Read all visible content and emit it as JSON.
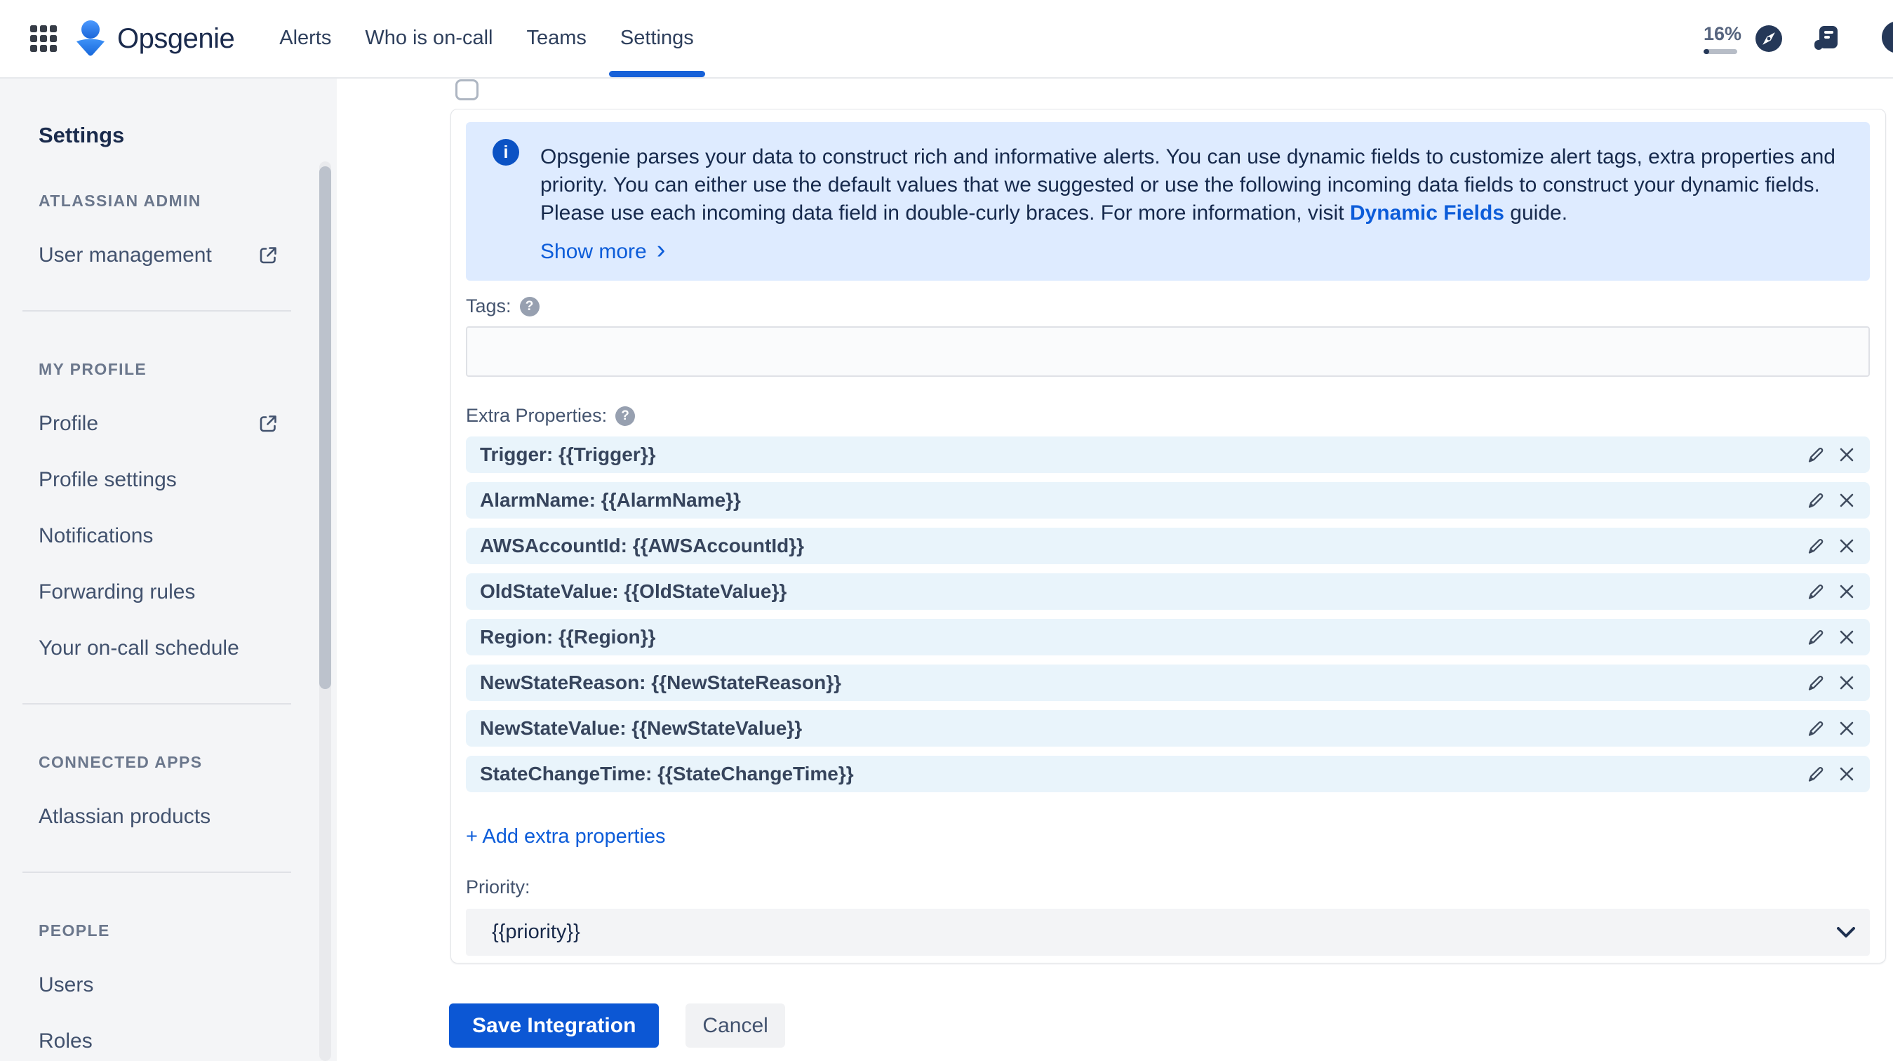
{
  "header": {
    "brand": "Opsgenie",
    "nav": [
      {
        "label": "Alerts",
        "active": false
      },
      {
        "label": "Who is on-call",
        "active": false
      },
      {
        "label": "Teams",
        "active": false
      },
      {
        "label": "Settings",
        "active": true
      }
    ],
    "usage_percent": "16%",
    "usage_fraction": 0.16,
    "help_glyph": "?",
    "icons": {
      "app_switcher": "app-switcher-grid",
      "compass": "compass-explore",
      "release_notes": "release-notes-document",
      "help": "question-mark-circle"
    }
  },
  "sidebar": {
    "title": "Settings",
    "sections": [
      {
        "label": "ATLASSIAN ADMIN",
        "items": [
          {
            "label": "User management",
            "external": true
          }
        ]
      },
      {
        "label": "MY PROFILE",
        "items": [
          {
            "label": "Profile",
            "external": true
          },
          {
            "label": "Profile settings",
            "external": false
          },
          {
            "label": "Notifications",
            "external": false
          },
          {
            "label": "Forwarding rules",
            "external": false
          },
          {
            "label": "Your on-call schedule",
            "external": false
          }
        ]
      },
      {
        "label": "CONNECTED APPS",
        "items": [
          {
            "label": "Atlassian products",
            "external": false
          }
        ]
      },
      {
        "label": "PEOPLE",
        "items": [
          {
            "label": "Users",
            "external": false
          },
          {
            "label": "Roles",
            "external": false
          }
        ]
      }
    ]
  },
  "main": {
    "banner": {
      "line1": "Opsgenie parses your data to construct rich and informative alerts. You can use dynamic fields to customize alert tags, extra properties and",
      "line2": "priority. You can either use the default values that we suggested or use the following incoming data fields to construct your dynamic fields.",
      "line3_pre": "Please use each incoming data field in double-curly braces. For more information, visit ",
      "line3_link": "Dynamic Fields",
      "line3_post": " guide.",
      "show_more": "Show more",
      "show_more_chevron": "›",
      "info_glyph": "i"
    },
    "tags": {
      "label": "Tags:",
      "value": "",
      "help_glyph": "?"
    },
    "extra_properties": {
      "label": "Extra Properties:",
      "help_glyph": "?",
      "rows": [
        "Trigger: {{Trigger}}",
        "AlarmName: {{AlarmName}}",
        "AWSAccountId: {{AWSAccountId}}",
        "OldStateValue: {{OldStateValue}}",
        "Region: {{Region}}",
        "NewStateReason: {{NewStateReason}}",
        "NewStateValue: {{NewStateValue}}",
        "StateChangeTime: {{StateChangeTime}}"
      ],
      "add_label": "+ Add extra properties"
    },
    "priority": {
      "label": "Priority:",
      "value": "{{priority}}"
    },
    "buttons": {
      "save": "Save Integration",
      "cancel": "Cancel"
    }
  },
  "colors": {
    "brand_navy": "#172B4D",
    "accent_blue": "#0C5CD9",
    "tab_underline": "#1761D8",
    "banner_bg": "#DEEBFF",
    "info_icon_bg": "#0B52C4",
    "row_bg": "#E9F4FB",
    "sidebar_bg": "#F4F5F7",
    "save_button_bg": "#0C57D4",
    "cancel_button_bg": "#F1F2F4",
    "usage_fill": "#253858"
  }
}
